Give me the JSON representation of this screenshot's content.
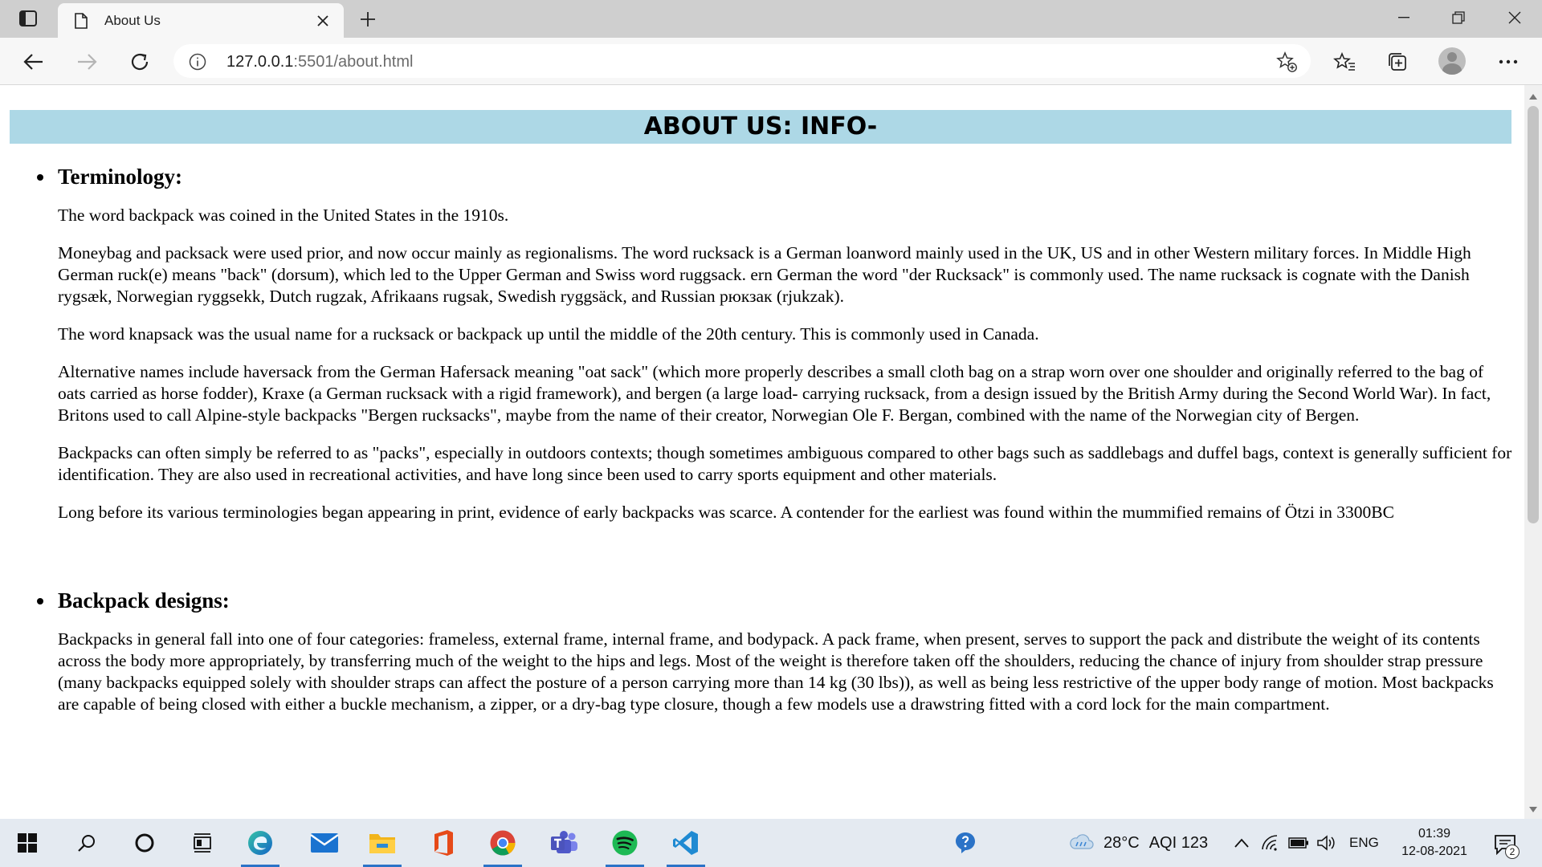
{
  "browser": {
    "tab_title": "About Us",
    "url_host": "127.0.0.1",
    "url_rest": ":5501/about.html"
  },
  "page": {
    "banner": "ABOUT US: INFO-",
    "sections": [
      {
        "heading": "Terminology:",
        "paragraphs": [
          "The word backpack was coined in the United States in the 1910s.",
          "Moneybag and packsack were used prior, and now occur mainly as regionalisms. The word rucksack is a German loanword mainly used in the UK, US and in other Western military forces. In Middle High German ruck(e) means \"back\" (dorsum), which led to the Upper German and Swiss word ruggsack. ern German the word \"der Rucksack\" is commonly used. The name rucksack is cognate with the Danish rygsæk, Norwegian ryggsekk, Dutch rugzak, Afrikaans rugsak, Swedish ryggsäck, and Russian рюкзак (rjukzak).",
          "The word knapsack was the usual name for a rucksack or backpack up until the middle of the 20th century. This is commonly used in Canada.",
          "Alternative names include haversack from the German Hafersack meaning \"oat sack\" (which more properly describes a small cloth bag on a strap worn over one shoulder and originally referred to the bag of oats carried as horse fodder), Kraxe (a German rucksack with a rigid framework), and bergen (a large load- carrying rucksack, from a design issued by the British Army during the Second World War). In fact, Britons used to call Alpine-style backpacks \"Bergen rucksacks\", maybe from the name of their creator, Norwegian Ole F. Bergan, combined with the name of the Norwegian city of Bergen.",
          "Backpacks can often simply be referred to as \"packs\", especially in outdoors contexts; though sometimes ambiguous compared to other bags such as saddlebags and duffel bags, context is generally sufficient for identification. They are also used in recreational activities, and have long since been used to carry sports equipment and other materials.",
          "Long before its various terminologies began appearing in print, evidence of early backpacks was scarce. A contender for the earliest was found within the mummified remains of Ötzi in 3300BC"
        ]
      },
      {
        "heading": "Backpack designs:",
        "paragraphs": [
          "Backpacks in general fall into one of four categories: frameless, external frame, internal frame, and bodypack. A pack frame, when present, serves to support the pack and distribute the weight of its contents across the body more appropriately, by transferring much of the weight to the hips and legs. Most of the weight is therefore taken off the shoulders, reducing the chance of injury from shoulder strap pressure (many backpacks equipped solely with shoulder straps can affect the posture of a person carrying more than 14 kg (30 lbs)), as well as being less restrictive of the upper body range of motion. Most backpacks are capable of being closed with either a buckle mechanism, a zipper, or a dry-bag type closure, though a few models use a drawstring fitted with a cord lock for the main compartment."
        ]
      }
    ]
  },
  "taskbar": {
    "weather_temp": "28°C",
    "weather_aqi": "AQI 123",
    "language": "ENG",
    "time": "01:39",
    "date": "12-08-2021",
    "notification_count": "2"
  }
}
